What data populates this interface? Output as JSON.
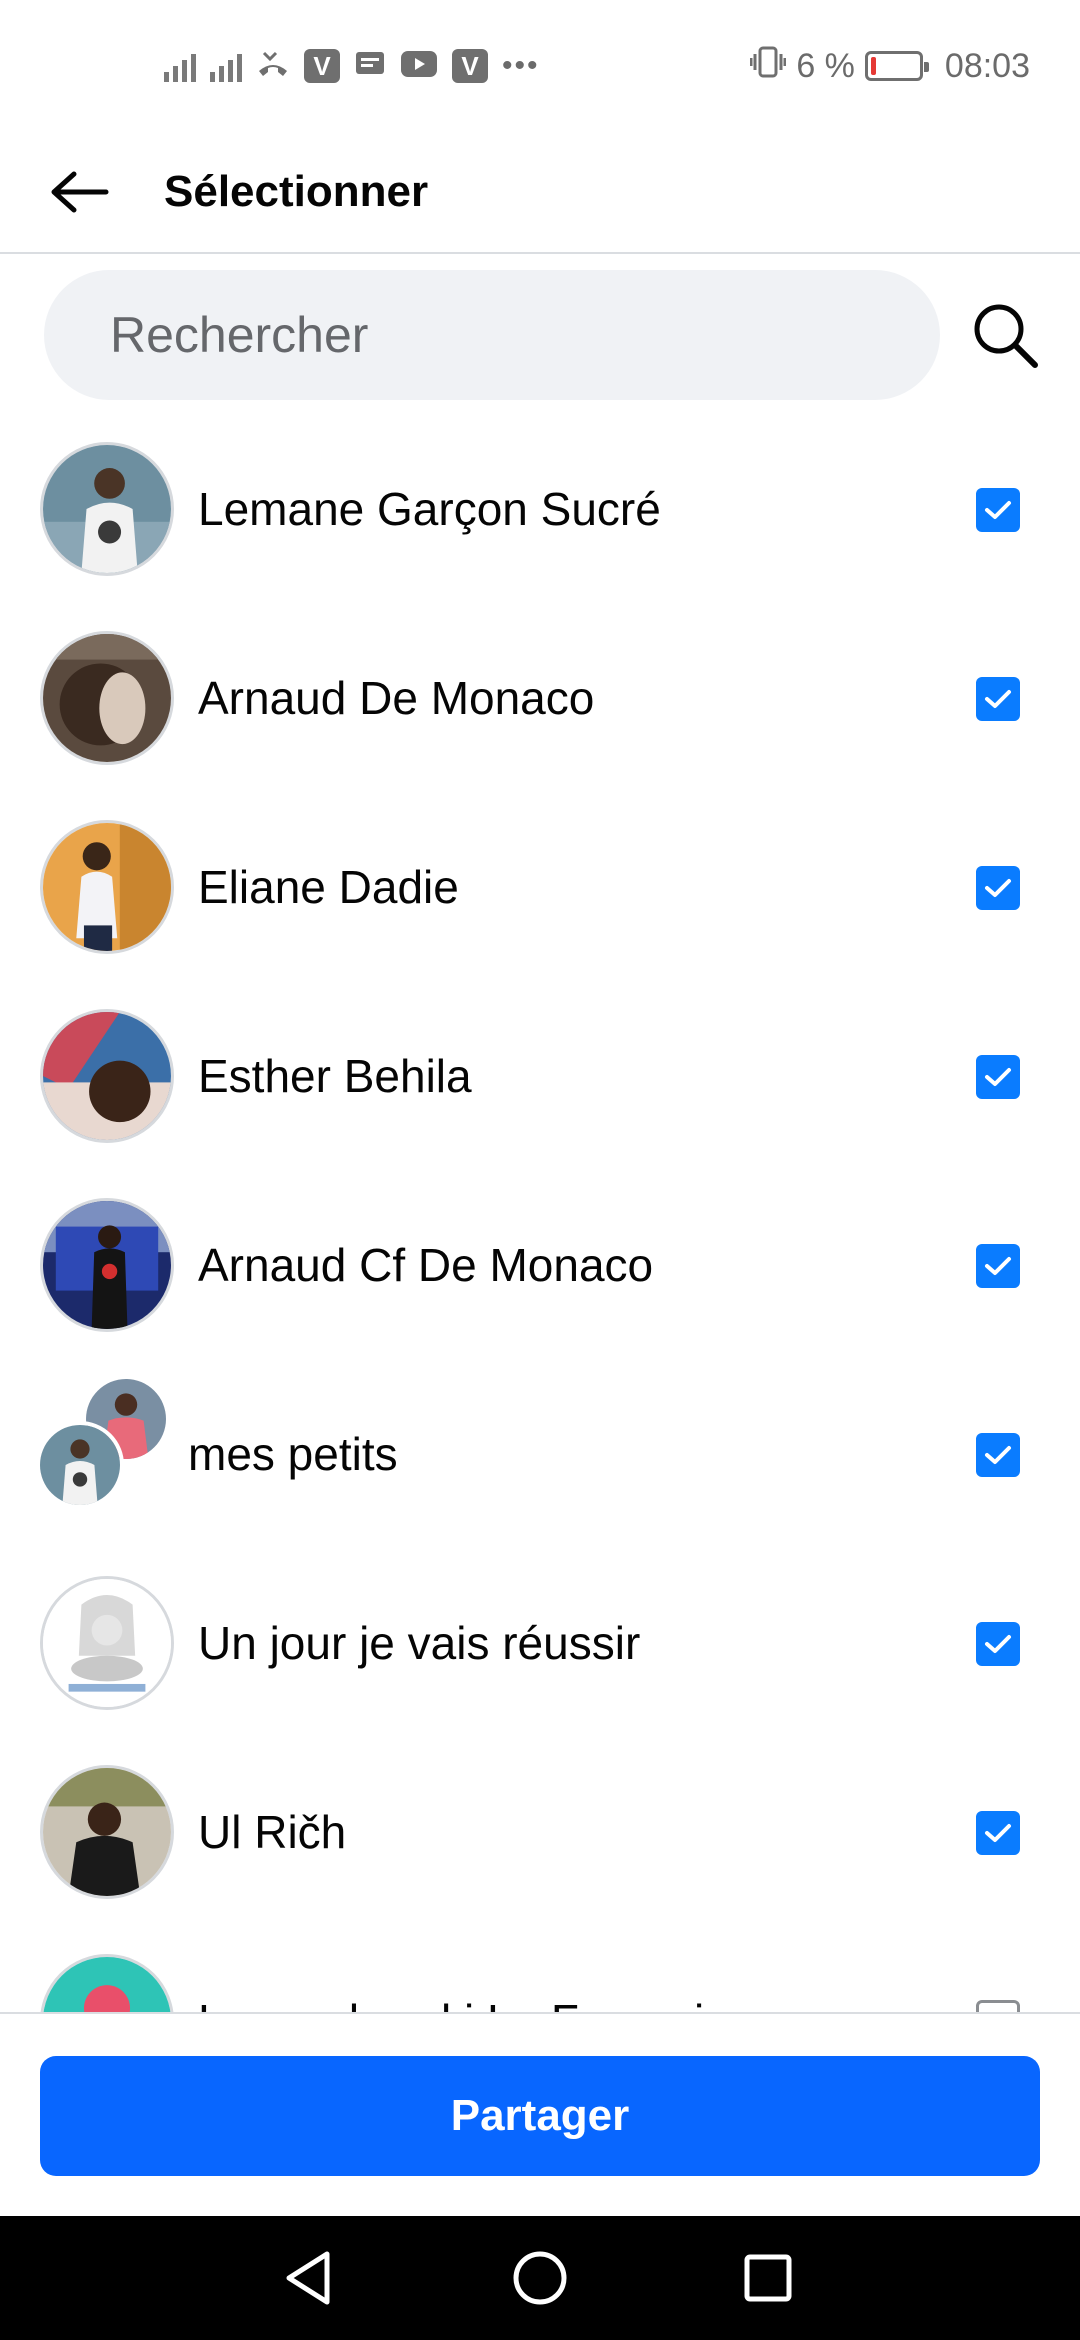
{
  "status_bar": {
    "time": "08:03",
    "battery_percent": "6 %",
    "icons": [
      "signal-icon",
      "signal-h-plus-icon",
      "missed-call-icon",
      "viber-icon",
      "message-icon",
      "youtube-icon",
      "viber-icon",
      "more-dots-icon",
      "vibrate-icon",
      "battery-icon"
    ]
  },
  "header": {
    "title": "Sélectionner"
  },
  "search": {
    "placeholder": "Rechercher"
  },
  "contacts": [
    {
      "name": "Lemane Garçon Sucré",
      "checked": true
    },
    {
      "name": "Arnaud De Monaco",
      "checked": true
    },
    {
      "name": "Eliane Dadie",
      "checked": true
    },
    {
      "name": "Esther Behila",
      "checked": true
    },
    {
      "name": "Arnaud Cf De Monaco",
      "checked": true
    },
    {
      "name": "mes petits",
      "checked": true
    },
    {
      "name": " Un jour je vais réussir",
      "checked": true
    },
    {
      "name": "Ul Rič‌h",
      "checked": true
    },
    {
      "name": "Lewandowski Le Francai",
      "checked": false
    }
  ],
  "footer": {
    "share_label": "Partager"
  },
  "colors": {
    "accent": "#0866ff",
    "checkbox": "#0a7cff",
    "search_bg": "#f0f2f5"
  }
}
